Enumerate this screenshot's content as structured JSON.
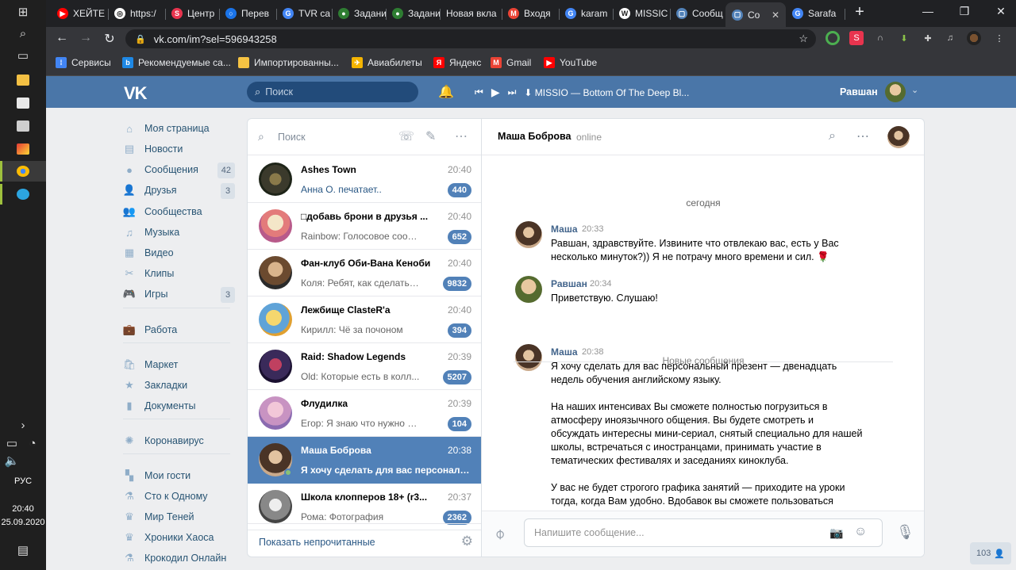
{
  "taskbar": {
    "lang": "РУС",
    "time": "20:40",
    "date": "25.09.2020",
    "icons": [
      "windows-start-icon",
      "search-icon",
      "task-view-icon",
      "file-explorer-icon",
      "store-icon",
      "photos-icon",
      "app-icon",
      "chrome-icon",
      "telegram-icon"
    ]
  },
  "browser": {
    "tabs": [
      {
        "label": "ХЕЙТЕ",
        "color": "#ff0000",
        "letter": "▶"
      },
      {
        "label": "https:/",
        "color": "#ffffff",
        "letter": "◎"
      },
      {
        "label": "Центр",
        "color": "#e8344e",
        "letter": "S"
      },
      {
        "label": "Перев",
        "color": "#1a73e8",
        "letter": "○"
      },
      {
        "label": "TVR са",
        "color": "#4285f4",
        "letter": "G"
      },
      {
        "label": "Задани",
        "color": "#2e7d32",
        "letter": "●"
      },
      {
        "label": "Задани",
        "color": "#2e7d32",
        "letter": "●"
      },
      {
        "label": "Новая вкла",
        "color": "",
        "letter": ""
      },
      {
        "label": "Входя",
        "color": "#ea4335",
        "letter": "M"
      },
      {
        "label": "karam",
        "color": "#4285f4",
        "letter": "G"
      },
      {
        "label": "MISSIC",
        "color": "#ffffff",
        "letter": "W"
      },
      {
        "label": "Сообщ",
        "color": "#5181b8",
        "letter": "▢"
      },
      {
        "label": "Со",
        "color": "#5181b8",
        "letter": "▢"
      },
      {
        "label": "Sarafa",
        "color": "#4285f4",
        "letter": "G"
      }
    ],
    "new_tab": "+",
    "url": "vk.com/im?sel=596943258",
    "bookmarks": [
      {
        "label": "Сервисы",
        "color": "#4285f4",
        "letter": "⁞"
      },
      {
        "label": "Рекомендуемые са...",
        "color": "#1e88e5",
        "letter": "b"
      },
      {
        "label": "Импортированны...",
        "color": "#f6c343",
        "letter": ""
      },
      {
        "label": "Авиабилеты",
        "color": "#f4b400",
        "letter": "✈"
      },
      {
        "label": "Яндекс",
        "color": "#ff0000",
        "letter": "Я"
      },
      {
        "label": "Gmail",
        "color": "#ea4335",
        "letter": "M"
      },
      {
        "label": "YouTube",
        "color": "#ff0000",
        "letter": "▶"
      }
    ]
  },
  "vk": {
    "logo": "VK",
    "search_placeholder": "Поиск",
    "track": "MISSIO — Bottom Of The Deep Bl...",
    "user": "Равшан",
    "menu": [
      {
        "label": "Моя страница",
        "icon": "home-icon",
        "glyph": "⌂",
        "count": ""
      },
      {
        "label": "Новости",
        "icon": "news-icon",
        "glyph": "▤",
        "count": ""
      },
      {
        "label": "Сообщения",
        "icon": "messages-icon",
        "glyph": "●",
        "count": "42"
      },
      {
        "label": "Друзья",
        "icon": "friends-icon",
        "glyph": "👤",
        "count": "3"
      },
      {
        "label": "Сообщества",
        "icon": "groups-icon",
        "glyph": "👥",
        "count": ""
      },
      {
        "label": "Музыка",
        "icon": "music-icon",
        "glyph": "♫",
        "count": ""
      },
      {
        "label": "Видео",
        "icon": "video-icon",
        "glyph": "▦",
        "count": ""
      },
      {
        "label": "Клипы",
        "icon": "clips-icon",
        "glyph": "✂",
        "count": ""
      },
      {
        "label": "Игры",
        "icon": "games-icon",
        "glyph": "🎮",
        "count": "3"
      },
      {
        "label": "Работа",
        "icon": "work-icon",
        "glyph": "💼",
        "count": ""
      },
      {
        "label": "Маркет",
        "icon": "market-icon",
        "glyph": "🛍",
        "count": ""
      },
      {
        "label": "Закладки",
        "icon": "bookmarks-icon",
        "glyph": "★",
        "count": ""
      },
      {
        "label": "Документы",
        "icon": "documents-icon",
        "glyph": "▮",
        "count": ""
      },
      {
        "label": "Коронавирус",
        "icon": "coronavirus-icon",
        "glyph": "✺",
        "count": ""
      },
      {
        "label": "Мои гости",
        "icon": "guests-app-icon",
        "glyph": "▚",
        "count": ""
      },
      {
        "label": "Сто к Одному",
        "icon": "app-flask-icon",
        "glyph": "⚗",
        "count": ""
      },
      {
        "label": "Мир Теней",
        "icon": "app-crown-icon",
        "glyph": "♛",
        "count": ""
      },
      {
        "label": "Хроники Хаоса",
        "icon": "app-crown-icon",
        "glyph": "♛",
        "count": ""
      },
      {
        "label": "Крокодил Онлайн",
        "icon": "app-flask-icon",
        "glyph": "⚗",
        "count": ""
      }
    ],
    "dialog_search_placeholder": "Поиск",
    "dialogs": [
      {
        "title": "Ashes Town",
        "time": "20:40",
        "preview": "Анна О. печатает..",
        "typing": true,
        "badge": "440",
        "ava": "radial-gradient(circle,#8a7a4a 0 25%,#3b3a2c 26% 60%,#1e2418 61%)"
      },
      {
        "title": "□добавь брони в друзья ...",
        "time": "20:40",
        "preview": "Rainbow: Голосовое сооб...",
        "typing": false,
        "badge": "652",
        "ava": "radial-gradient(circle at 50% 40%,#f4e6c8 0 30%,#e37b7b 31% 55%,#b85a8a 56%)"
      },
      {
        "title": "Фан-клуб Оби-Вана Кеноби",
        "time": "20:40",
        "preview": "Коля: Ребят, как сделать ...",
        "typing": false,
        "badge": "9832",
        "ava": "radial-gradient(circle at 50% 40%,#d9b48c 0 28%,#6b4a2f 29% 60%,#2a2a2a 61%)"
      },
      {
        "title": "Лежбище ClasteR'a",
        "time": "20:40",
        "preview": "Кирилл: Чё за почоном",
        "typing": false,
        "badge": "394",
        "ava": "radial-gradient(circle at 45% 45%,#f5d76e 0 30%,#5fa3d8 31% 60%,#e0a030 61%)"
      },
      {
        "title": "Raid: Shadow Legends",
        "time": "20:39",
        "preview": "Old: Которые есть в колл...",
        "typing": false,
        "badge": "5207",
        "ava": "radial-gradient(circle at 50% 45%,#c04060 0 25%,#3a2a5a 26% 60%,#1a1030 61%)"
      },
      {
        "title": "Флудилка",
        "time": "20:39",
        "preview": "Егор: Я знаю что нужно д...",
        "typing": false,
        "badge": "104",
        "ava": "radial-gradient(circle at 50% 40%,#f2c7d8 0 30%,#c893c2 31% 60%,#8a6ab0 61%)"
      },
      {
        "title": "Маша Боброва",
        "time": "20:38",
        "preview": "Я хочу сделать для вас персональны...",
        "typing": false,
        "badge": "",
        "ava": "radial-gradient(circle at 50% 42%,#e2c3a0 0 26%,#4a3426 27% 62%,#c9a98a 63%)",
        "active": true
      },
      {
        "title": "Школа клопперов 18+ (r3...",
        "time": "20:37",
        "preview": "Рома: Фотография",
        "typing": false,
        "badge": "2362",
        "ava": "radial-gradient(circle at 50% 45%,#eeeeee 0 25%,#888 26% 60%,#444 61%)"
      }
    ],
    "show_unread": "Показать непрочитанные",
    "chat": {
      "name": "Маша Боброва",
      "status": "online",
      "date_sep": "сегодня",
      "new_sep": "Новые сообщения",
      "messages": [
        {
          "author": "Маша",
          "time": "20:33",
          "text": "Равшан, здравствуйте. Извините что отвлекаю вас, есть у Вас\nнесколько минуток?)) Я не потрачу много времени и сил. 🌹"
        },
        {
          "author": "Равшан",
          "time": "20:34",
          "text": "Приветствую. Слушаю!"
        },
        {
          "author": "Маша",
          "time": "20:38",
          "text": "Я хочу сделать для вас персональный презент — двенадцать\nнедель обучения английскому языку.\n\nНа наших интенсивах Вы сможете полностью погрузиться в\nатмосферу иноязычного общения. Вы будете смотреть и\nобсуждать интересны мини-сериал, снятый специально для нашей\nшколы, встречаться с иностранцами, принимать участие в\nтематических фестивалях и заседаниях киноклуба.\n\nУ вас не будет строгого графика занятий — приходите на уроки\nтогда, когда Вам удобно. Вдобавок вы сможете пользоваться\nуникальной образовательной платформой и эл. книгами"
        }
      ],
      "input_placeholder": "Напишите сообщение..."
    },
    "online_count": "103"
  }
}
